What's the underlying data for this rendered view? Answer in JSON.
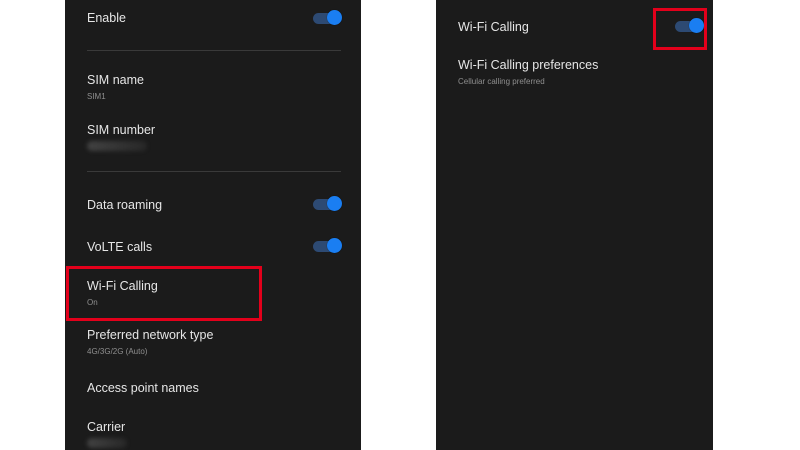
{
  "left_screen": {
    "items": [
      {
        "title": "Enable",
        "toggle": "on"
      },
      {
        "title": "SIM name",
        "subtitle": "SIM1"
      },
      {
        "title": "SIM number",
        "subtitle_hidden": true
      },
      {
        "title": "Data roaming",
        "toggle": "on"
      },
      {
        "title": "VoLTE calls",
        "toggle": "on"
      },
      {
        "title": "Wi-Fi Calling",
        "subtitle": "On",
        "highlighted": true
      },
      {
        "title": "Preferred network type",
        "subtitle": "4G/3G/2G (Auto)"
      },
      {
        "title": "Access point names"
      },
      {
        "title": "Carrier"
      }
    ]
  },
  "right_screen": {
    "items": [
      {
        "title": "Wi-Fi Calling",
        "toggle": "on",
        "toggle_highlighted": true
      },
      {
        "title": "Wi-Fi Calling preferences",
        "subtitle": "Cellular calling preferred"
      }
    ]
  },
  "colors": {
    "screen_background": "#1b1b1b",
    "toggle_thumb": "#1a7ef2",
    "toggle_track": "#2d4a73",
    "highlight": "#e3001b"
  }
}
